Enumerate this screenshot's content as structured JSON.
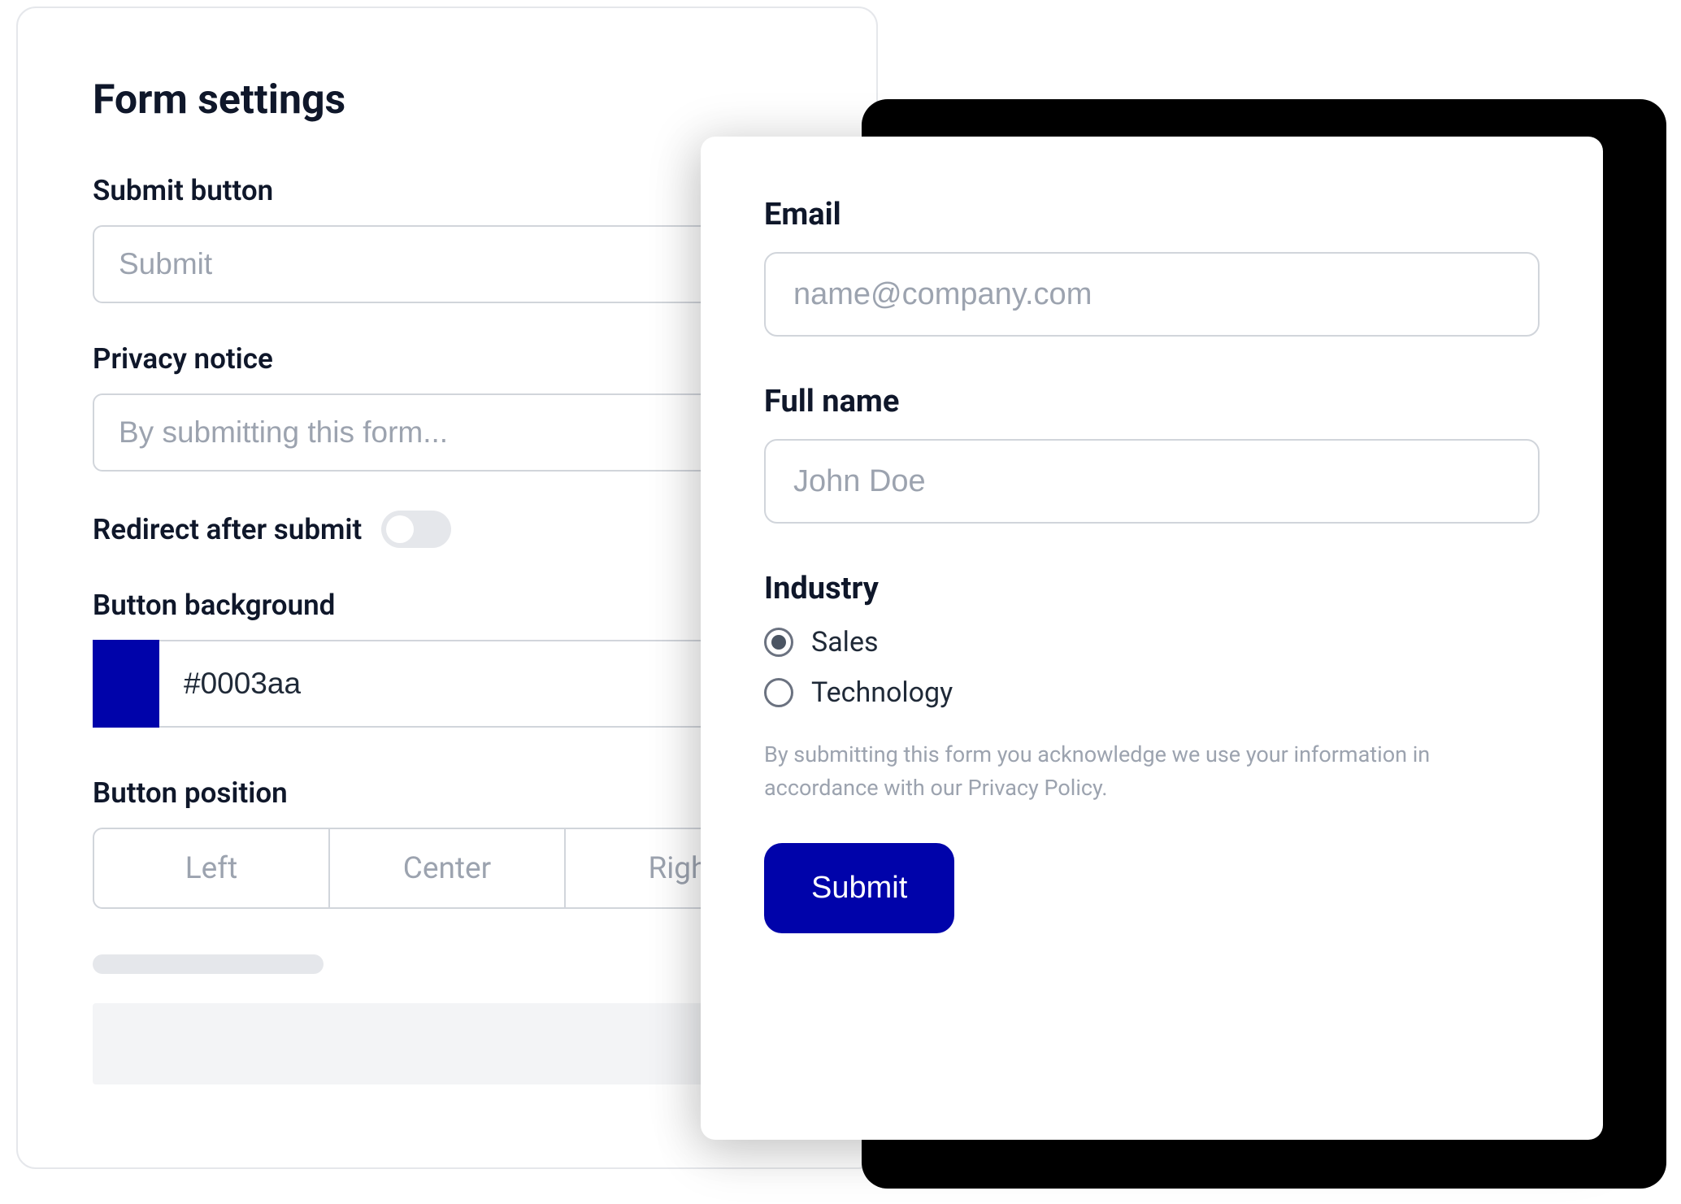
{
  "settings": {
    "title": "Form settings",
    "submit_button": {
      "label": "Submit button",
      "placeholder": "Submit"
    },
    "privacy_notice": {
      "label": "Privacy notice",
      "placeholder": "By submitting this form..."
    },
    "redirect": {
      "label": "Redirect after submit",
      "enabled": false
    },
    "button_background": {
      "label": "Button background",
      "value": "#0003aa",
      "swatch": "#0003aa"
    },
    "button_position": {
      "label": "Button position",
      "options": [
        "Left",
        "Center",
        "Right"
      ]
    }
  },
  "preview": {
    "email": {
      "label": "Email",
      "placeholder": "name@company.com"
    },
    "full_name": {
      "label": "Full name",
      "placeholder": "John Doe"
    },
    "industry": {
      "label": "Industry",
      "options": [
        {
          "label": "Sales",
          "checked": true
        },
        {
          "label": "Technology",
          "checked": false
        }
      ]
    },
    "privacy_text": "By submitting this form you acknowledge we use your information in accordance with our Privacy Policy.",
    "submit_label": "Submit"
  }
}
